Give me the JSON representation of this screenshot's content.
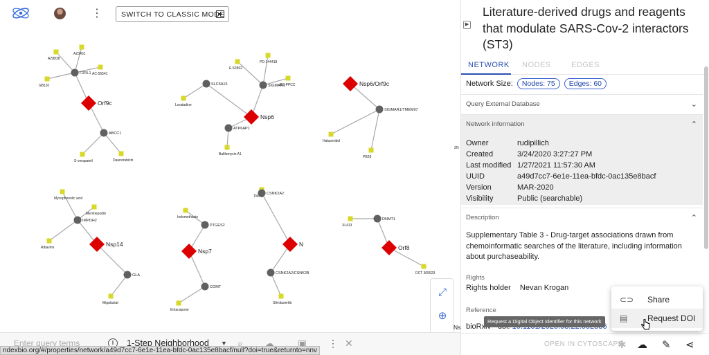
{
  "toolbar": {
    "logo_icon": "ndex-logo-icon",
    "avatar_icon": "user-avatar-icon",
    "more_icon": "vertical-dots-icon",
    "classic_mode_label": "SWITCH TO CLASSIC MODE",
    "classic_mode_icon": "window-icon"
  },
  "network": {
    "hub_color": "#dd0000",
    "gene_color": "#606060",
    "drug_color": "#d8d82a",
    "hubs": [
      "Orf9c",
      "Nsp6",
      "Nsp6/Orf9c",
      "Nsp14",
      "Nsp7",
      "N",
      "Orf8",
      "Ns"
    ],
    "genes": [
      "F2RL1",
      "ABCC1",
      "SLC6A15",
      "SIGMAR1",
      "ATP6AP1",
      "SIGMAR1/TMEM97",
      "IMPDH2",
      "GLA",
      "PTGES2",
      "COMT",
      "CSNK2A2",
      "CSNK2A2/CSNK2B",
      "DNMT1"
    ],
    "drugs": [
      "AZ8838",
      "AZ3451",
      "AC-55541",
      "GB110",
      "S-verapamil",
      "Daunorubicin",
      "E-52862",
      "PD-144418",
      "RS-PPCC",
      "Loratadine",
      "Bafilomycin A1",
      "Haloperidol",
      "PB28",
      "Mycophenolic acid",
      "Merimepodib",
      "Ribavirin",
      "Migalastat",
      "Indomethacin",
      "Entacapone",
      "TMCB",
      "Silmitasertib",
      "XL413",
      "DCT 305523"
    ],
    "edge_label": "ZN"
  },
  "zoom_controls": {
    "fit_icon": "fit-screen-icon",
    "zoom_in_icon": "zoom-in-icon",
    "zoom_out_icon": "zoom-out-icon"
  },
  "query": {
    "placeholder": "Enter query terms",
    "mode": "1-Step Neighborhood",
    "info_icon": "info-icon",
    "search_icon": "search-icon",
    "upload_icon": "cloud-upload-icon",
    "save_icon": "save-icon",
    "more_icon": "vertical-dots-icon",
    "close_icon": "close-icon"
  },
  "status_url": "ndexbio.org/#/properties/network/a49d7cc7-6e1e-11ea-bfdc-0ac135e8bacf/null?doi=true&returnto=nnv",
  "panel": {
    "title": "Literature-derived drugs and reagents that modulate SARS-Cov-2 interactors (ST3)",
    "tabs": [
      "NETWORK",
      "NODES",
      "EDGES"
    ],
    "network_size_label": "Network Size:",
    "nodes_chip": "Nodes: 75",
    "edges_chip": "Edges: 60",
    "query_external_db": "Query External Database",
    "network_information": "Network information",
    "info": [
      {
        "key": "Owner",
        "value": "rudipillich"
      },
      {
        "key": "Created",
        "value": "3/24/2020 3:27:27 PM"
      },
      {
        "key": "Last modified",
        "value": "1/27/2021 11:57:30 AM"
      },
      {
        "key": "UUID",
        "value": "a49d7cc7-6e1e-11ea-bfdc-0ac135e8bacf"
      },
      {
        "key": "Version",
        "value": "MAR-2020"
      },
      {
        "key": "Visibility",
        "value": "Public (searchable)"
      }
    ],
    "description_label": "Description",
    "description": "Supplementary Table 3 - Drug-target associations drawn from chemoinformatic searches of the literature, including information about purchaseability.",
    "rights_label": "Rights",
    "rights_holder_key": "Rights holder",
    "rights_holder_value": "Nevan Krogan",
    "reference_label": "Reference",
    "reference_prefix": "bioRxiv - doi: ",
    "reference_link": "10.1101/2020.03.22.002386"
  },
  "footer": {
    "cytoscape_label": "OPEN IN CYTOSCAPE",
    "cytoscape_icon": "cytoscape-icon",
    "download_icon": "cloud-download-icon",
    "edit_icon": "edit-pencil-icon",
    "share_icon": "share-icon"
  },
  "menu": {
    "share_label": "Share",
    "share_icon": "link-icon",
    "doi_label": "Request DOI",
    "doi_icon": "library-books-icon",
    "tooltip": "Request a Digital Object Identifier for this network"
  }
}
